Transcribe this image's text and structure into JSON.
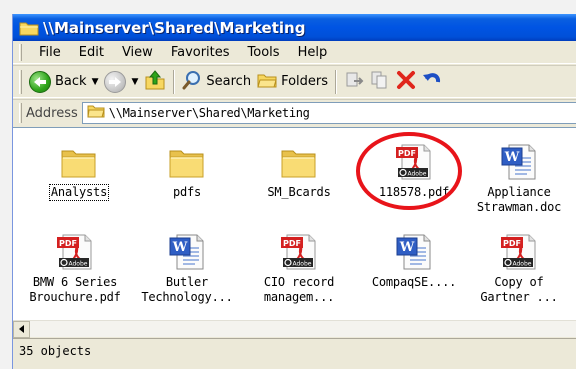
{
  "window": {
    "title": "\\\\Mainserver\\Shared\\Marketing"
  },
  "menu": [
    "File",
    "Edit",
    "View",
    "Favorites",
    "Tools",
    "Help"
  ],
  "toolbar": {
    "back_label": "Back",
    "search_label": "Search",
    "folders_label": "Folders"
  },
  "address": {
    "label": "Address",
    "value": "\\\\Mainserver\\Shared\\Marketing"
  },
  "items": [
    {
      "name": "Analysts",
      "type": "folder"
    },
    {
      "name": "pdfs",
      "type": "folder"
    },
    {
      "name": "SM_Bcards",
      "type": "folder"
    },
    {
      "name": "118578.pdf",
      "type": "pdf"
    },
    {
      "name": "Appliance\nStrawman.doc",
      "type": "word"
    },
    {
      "name": "BMW 6 Series\nBrouchure.pdf",
      "type": "pdf"
    },
    {
      "name": "Butler\nTechnology...",
      "type": "word"
    },
    {
      "name": "CIO record\nmanagem...",
      "type": "pdf"
    },
    {
      "name": "CompaqSE....",
      "type": "word"
    },
    {
      "name": "Copy of\nGartner ...",
      "type": "pdf"
    }
  ],
  "icon_labels": {
    "pdf_badge": "PDF",
    "adobe": "Adobe",
    "word_letter": "W"
  },
  "status": {
    "text": "35 objects"
  },
  "colors": {
    "titlebar": "#0054e3",
    "annotation": "#e8141a",
    "folder": "#f5d45d",
    "pdf_red": "#d42020",
    "word_blue": "#2f5ec4"
  }
}
